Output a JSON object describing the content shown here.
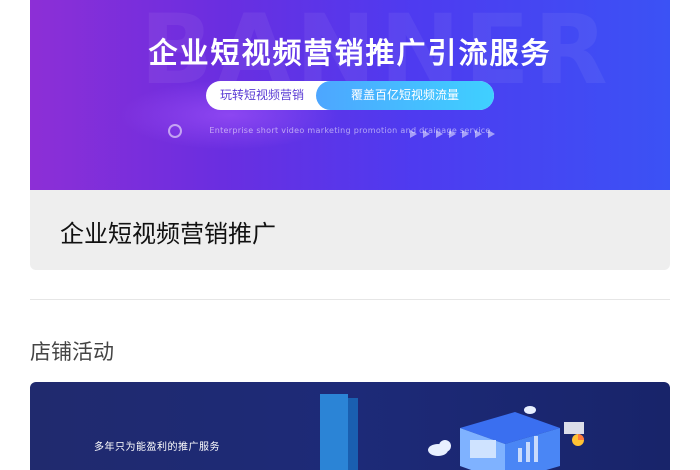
{
  "banner_card": {
    "title": "企业短视频营销推广引流服务",
    "ghost_text": "BANNER",
    "pill_left": "玩转短视频营销",
    "pill_right": "覆盖百亿短视频流量",
    "subtitle_en": "Enterprise short video marketing promotion and drainage service",
    "caption": "企业短视频营销推广"
  },
  "section": {
    "title": "店铺活动"
  },
  "promo": {
    "text": "多年只为能盈利的推广服务"
  },
  "colors": {
    "banner_start": "#8d2fd6",
    "banner_end": "#3b52f5",
    "pill_accent": "#4da6ff",
    "caption_bg": "#eeeeee",
    "promo_bg": "#1d2a78"
  }
}
